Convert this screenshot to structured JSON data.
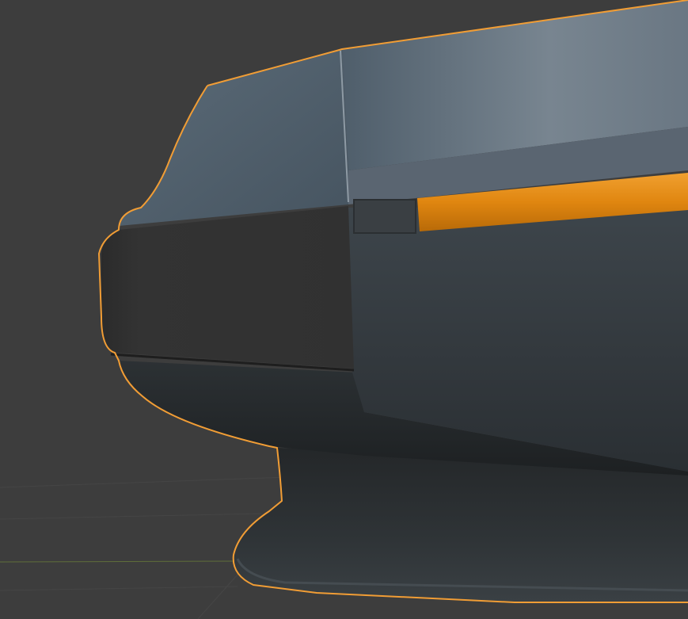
{
  "viewport": {
    "background_color": "#3d3d3d",
    "grid_line_color": "#4a4a4a",
    "x_axis_color": "#6b7d3c"
  },
  "selected_object": {
    "selection_outline_color": "#f19d35",
    "accent_strip_color": "#e58a0f",
    "body_top_color": "#6b7884",
    "body_side_color": "#2f3438",
    "bumper_color": "#323232",
    "base_color": "#272a2c"
  },
  "icons": {
    "object": "3d-mesh-object-icon"
  }
}
